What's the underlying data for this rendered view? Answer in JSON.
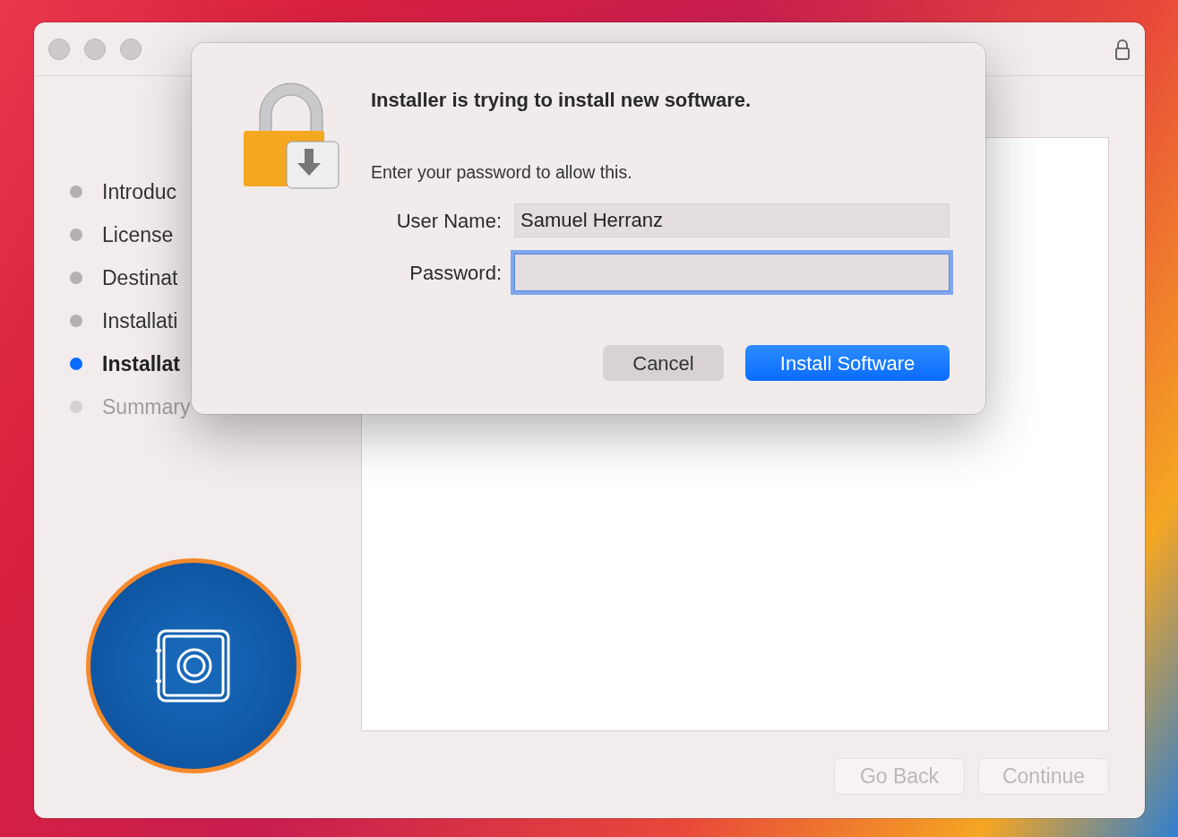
{
  "window": {
    "locked": true
  },
  "steps": [
    {
      "label": "Introduc",
      "selected": false,
      "disabled": false
    },
    {
      "label": "License",
      "selected": false,
      "disabled": false
    },
    {
      "label": "Destinat",
      "selected": false,
      "disabled": false
    },
    {
      "label": "Installati",
      "selected": false,
      "disabled": false
    },
    {
      "label": "Installat",
      "selected": true,
      "disabled": false
    },
    {
      "label": "Summary",
      "selected": false,
      "disabled": true
    }
  ],
  "dialog": {
    "title": "Installer is trying to install new software.",
    "message": "Enter your password to allow this.",
    "fields": [
      {
        "label": "User Name:",
        "value": "Samuel Herranz",
        "focused": false
      },
      {
        "label": "Password:",
        "focused": true
      }
    ],
    "buttons": [
      {
        "label": "Cancel",
        "default": false
      },
      {
        "label": "Install Software",
        "default": true
      }
    ]
  },
  "footer_buttons": [
    {
      "label": "Go Back",
      "disabled": true
    },
    {
      "label": "Continue",
      "disabled": true
    }
  ]
}
